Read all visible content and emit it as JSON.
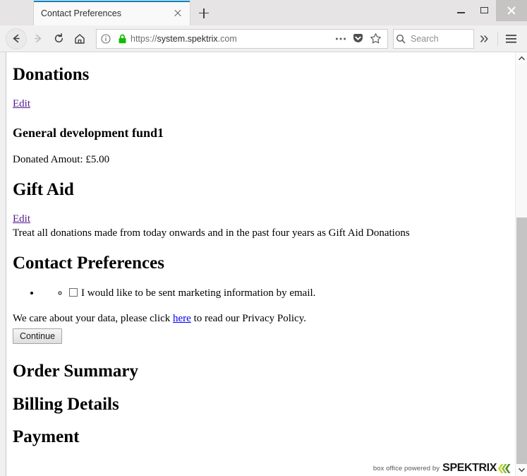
{
  "window": {
    "minimize_label": "Minimize",
    "maximize_label": "Maximize",
    "close_label": "Close"
  },
  "tabs": {
    "items": [
      {
        "title": "Contact Preferences",
        "active": true
      }
    ],
    "new_tab_label": "New Tab"
  },
  "toolbar": {
    "back_label": "Back",
    "forward_label": "Forward",
    "reload_label": "Reload",
    "home_label": "Home",
    "page_actions_label": "Page actions",
    "pocket_label": "Save to Pocket",
    "bookmark_label": "Bookmark this page",
    "overflow_label": "More tools",
    "menu_label": "Open menu"
  },
  "address_bar": {
    "scheme": "https://",
    "host": "system.spektrix",
    "rest": ".com",
    "full_value": "https://system.spektrix.com",
    "security_label": "Secure connection",
    "info_label": "Site information"
  },
  "search": {
    "placeholder": "Search",
    "value": ""
  },
  "page": {
    "donations": {
      "heading": "Donations",
      "edit_label": "Edit",
      "fund_name": "General development fund1",
      "amount_line": "Donated Amout: £5.00"
    },
    "gift_aid": {
      "heading": "Gift Aid",
      "edit_label": "Edit",
      "description": "Treat all donations made from today onwards and in the past four years as Gift Aid Donations"
    },
    "contact_preferences": {
      "heading": "Contact Preferences",
      "checkbox_label": "I would like to be sent marketing information by email.",
      "checkbox_checked": false,
      "privacy_before": "We care about your data, please click ",
      "privacy_link": "here",
      "privacy_after": " to read our Privacy Policy.",
      "continue_label": "Continue"
    },
    "order_summary": {
      "heading": "Order Summary"
    },
    "billing_details": {
      "heading": "Billing Details"
    },
    "payment": {
      "heading": "Payment"
    }
  },
  "footer": {
    "powered_text": "box office powered by",
    "brand": "SPEKTRIX"
  },
  "colors": {
    "tab_accent": "#0a84c1",
    "lock_green": "#12bc00",
    "visited_link": "#551a8b",
    "link": "#0000ee",
    "brand_green_light": "#c3d62e",
    "brand_green_mid": "#8cbf3f",
    "brand_green_dark": "#4f8a2e",
    "scrollbar_thumb": "#c5c4c4"
  }
}
